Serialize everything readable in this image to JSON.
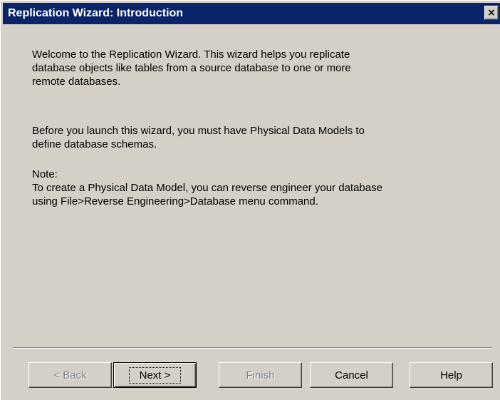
{
  "window": {
    "title": "Replication Wizard: Introduction",
    "close_glyph": "×"
  },
  "content": {
    "paragraph_1": "Welcome to the Replication Wizard. This wizard helps you replicate\ndatabase objects like tables from a source database to one or more\nremote databases.",
    "paragraph_2": "Before you launch this wizard, you must have Physical Data Models to\ndefine database schemas.",
    "paragraph_3": "Note:\nTo create a Physical Data Model, you can reverse engineer your database\nusing File>Reverse Engineering>Database menu command."
  },
  "buttons": {
    "back": "< Back",
    "next": "Next >",
    "finish": "Finish",
    "cancel": "Cancel",
    "help": "Help"
  },
  "colors": {
    "titlebar": "#0a246a",
    "dialog_face": "#d4d0c8",
    "disabled_text": "#808080"
  }
}
